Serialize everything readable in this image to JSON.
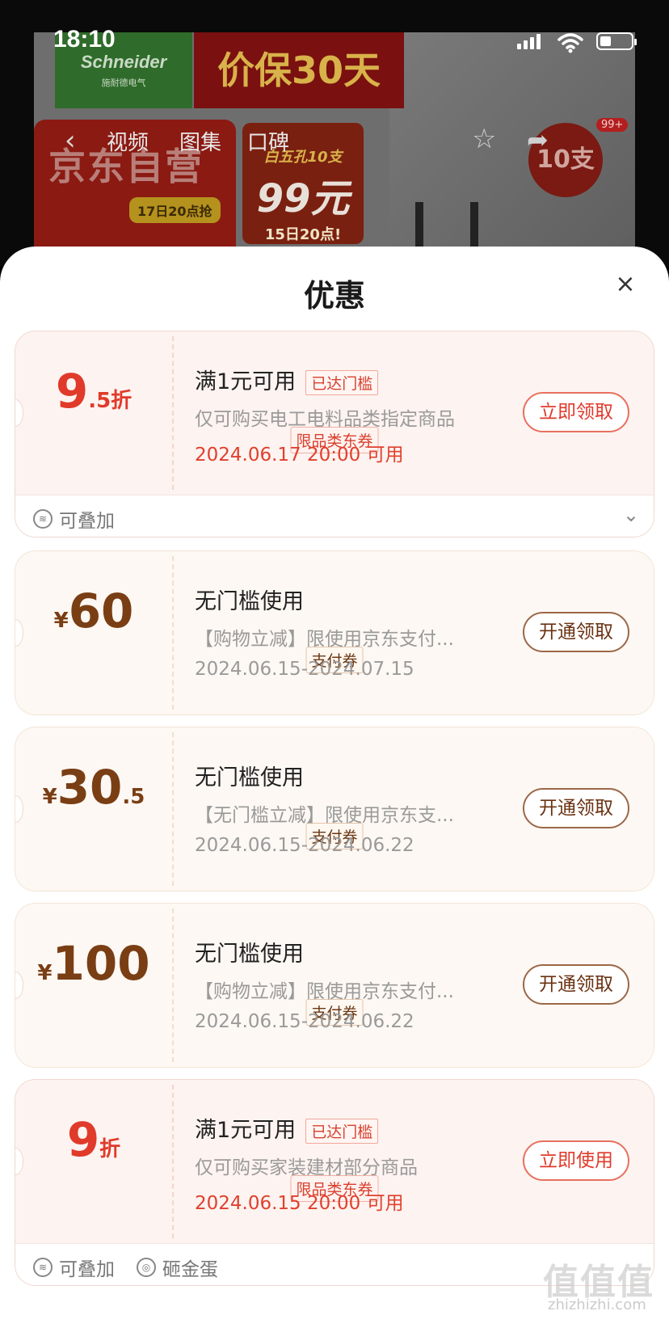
{
  "status_bar": {
    "time": "18:10"
  },
  "product_image": {
    "brand_name": "Schneider",
    "brand_sub": "施耐德电气",
    "price_protect": "价保30天",
    "jd_self": "京东自营",
    "jd_pill": "17日20点抢",
    "promo_line1": "白五孔10支",
    "promo_price": "99元",
    "promo_line3": "15日20点!",
    "star_badge": "10支"
  },
  "nav": {
    "tabs": [
      "视频",
      "图集",
      "口碑"
    ],
    "cart_badge": "99+"
  },
  "sheet": {
    "title": "优惠",
    "close_symbol": "×"
  },
  "coupons": [
    {
      "style": "red",
      "amount_main": "9",
      "amount_sub": ".5折",
      "type_tag": "限品类东券",
      "title": "满1元可用",
      "reach_badge": "已达门槛",
      "desc": "仅可购买电工电料品类指定商品",
      "date": "2024.06.17 20:00 可用",
      "action": "立即领取",
      "footer": [
        "可叠加"
      ]
    },
    {
      "style": "tan",
      "amount_prefix": "¥",
      "amount_main": "60",
      "amount_sub": "",
      "type_tag": "支付券",
      "title": "无门槛使用",
      "desc": "【购物立减】限使用京东支付...",
      "date": "2024.06.15-2024.07.15",
      "action": "开通领取"
    },
    {
      "style": "tan",
      "amount_prefix": "¥",
      "amount_main": "30",
      "amount_sub": ".5",
      "type_tag": "支付券",
      "title": "无门槛使用",
      "desc": "【无门槛立减】限使用京东支...",
      "date": "2024.06.15-2024.06.22",
      "action": "开通领取"
    },
    {
      "style": "tan",
      "amount_prefix": "¥",
      "amount_main": "100",
      "amount_sub": "",
      "type_tag": "支付券",
      "title": "无门槛使用",
      "desc": "【购物立减】限使用京东支付...",
      "date": "2024.06.15-2024.06.22",
      "action": "开通领取"
    },
    {
      "style": "red",
      "amount_main": "9",
      "amount_sub": "折",
      "type_tag": "限品类东券",
      "title": "满1元可用",
      "reach_badge": "已达门槛",
      "desc": "仅可购买家装建材部分商品",
      "date": "2024.06.15 20:00 可用",
      "action": "立即使用",
      "footer": [
        "可叠加",
        "砸金蛋"
      ]
    }
  ],
  "watermark": {
    "main": "值值值",
    "sub": "zhizhizhi.com"
  }
}
